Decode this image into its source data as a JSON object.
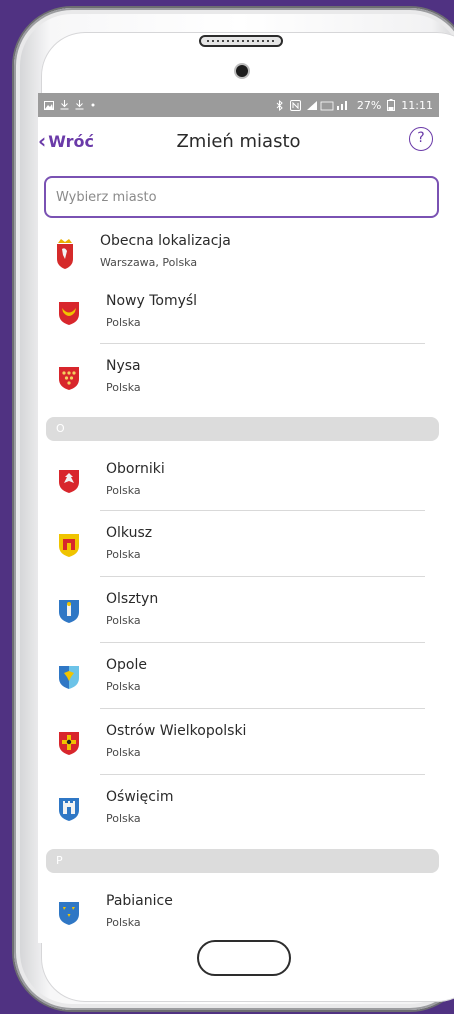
{
  "status_bar": {
    "left_icons": [
      "image-icon",
      "download-icon",
      "download-icon",
      "dot-icon"
    ],
    "right_text": "27%",
    "time": "11:11",
    "right_icons": [
      "bluetooth-icon",
      "nfc-icon",
      "signal-icon",
      "battery-icon"
    ]
  },
  "nav": {
    "back_label": "Wróć",
    "title": "Zmień miasto",
    "help_label": "?"
  },
  "search": {
    "placeholder": "Wybierz miasto",
    "value": ""
  },
  "current_location": {
    "title": "Obecna lokalizacja",
    "subtitle": "Warszawa, Polska"
  },
  "cities_n": [
    {
      "name": "Nowy Tomyśl",
      "country": "Polska"
    },
    {
      "name": "Nysa",
      "country": "Polska"
    }
  ],
  "section_o": "O",
  "cities_o": [
    {
      "name": "Oborniki",
      "country": "Polska"
    },
    {
      "name": "Olkusz",
      "country": "Polska"
    },
    {
      "name": "Olsztyn",
      "country": "Polska"
    },
    {
      "name": "Opole",
      "country": "Polska"
    },
    {
      "name": "Ostrów Wielkopolski",
      "country": "Polska"
    },
    {
      "name": "Oświęcim",
      "country": "Polska"
    }
  ],
  "section_p": "P",
  "cities_p": [
    {
      "name": "Pabianice",
      "country": "Polska"
    }
  ],
  "colors": {
    "accent": "#6a3aa8",
    "background": "#503282",
    "section_bg": "#dcdcdc"
  }
}
